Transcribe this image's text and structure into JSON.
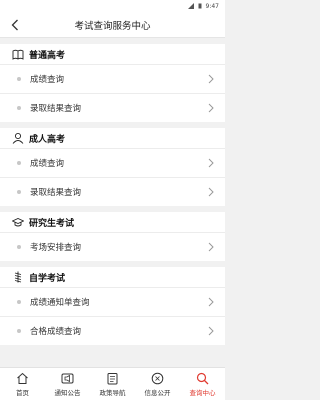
{
  "status": {
    "time": "9:47"
  },
  "header": {
    "title": "考试查询服务中心"
  },
  "groups": [
    {
      "title": "普通高考",
      "icon": "book-icon",
      "items": [
        {
          "label": "成绩查询"
        },
        {
          "label": "录取结果查询"
        }
      ]
    },
    {
      "title": "成人高考",
      "icon": "person-icon",
      "items": [
        {
          "label": "成绩查询"
        },
        {
          "label": "录取结果查询"
        }
      ]
    },
    {
      "title": "研究生考试",
      "icon": "graduation-cap-icon",
      "items": [
        {
          "label": "考场安排查询"
        }
      ]
    },
    {
      "title": "自学考试",
      "icon": "spring-icon",
      "items": [
        {
          "label": "成绩通知单查询"
        },
        {
          "label": "合格成绩查询"
        }
      ]
    }
  ],
  "tabs": [
    {
      "label": "首页",
      "icon": "home-icon",
      "active": false
    },
    {
      "label": "通知公告",
      "icon": "megaphone-icon",
      "active": false
    },
    {
      "label": "政策导航",
      "icon": "document-icon",
      "active": false
    },
    {
      "label": "信息公开",
      "icon": "info-icon",
      "active": false
    },
    {
      "label": "查询中心",
      "icon": "search-icon",
      "active": true
    }
  ],
  "colors": {
    "accent": "#e0392f",
    "background": "#f1f1f1"
  }
}
